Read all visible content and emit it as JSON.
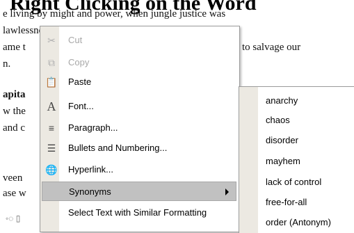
{
  "document": {
    "title": "Right Clicking on the Word",
    "lines": [
      "e living by might and power, when jungle justice was",
      "lawlessness pervaded almost every society and trade",
      "ame t",
      "to salvage our",
      "n.",
      "apita",
      "w the",
      "and c",
      "veen",
      "ase w"
    ]
  },
  "context_menu": {
    "items": [
      {
        "label": "Cut",
        "icon": "scissors-icon",
        "disabled": true
      },
      {
        "label": "Copy",
        "icon": "copy-icon",
        "disabled": true
      },
      {
        "label": "Paste",
        "icon": "paste-icon",
        "disabled": false
      },
      {
        "label": "Font...",
        "icon": "font-icon",
        "disabled": false
      },
      {
        "label": "Paragraph...",
        "icon": "paragraph-icon",
        "disabled": false
      },
      {
        "label": "Bullets and Numbering...",
        "icon": "bullets-icon",
        "disabled": false
      },
      {
        "label": "Hyperlink...",
        "icon": "hyperlink-icon",
        "disabled": false
      },
      {
        "label": "Synonyms",
        "icon": "",
        "disabled": false,
        "highlighted": true,
        "has_submenu": true
      },
      {
        "label": "Select Text with Similar Formatting",
        "icon": "",
        "disabled": false
      }
    ]
  },
  "synonyms_submenu": {
    "items": [
      "anarchy",
      "chaos",
      "disorder",
      "mayhem",
      "lack of control",
      "free-for-all",
      "order (Antonym)"
    ]
  },
  "colors": {
    "menu_gutter": "#ece9e2",
    "highlight": "#c1c1c1",
    "disabled_text": "#a8a8a8"
  }
}
